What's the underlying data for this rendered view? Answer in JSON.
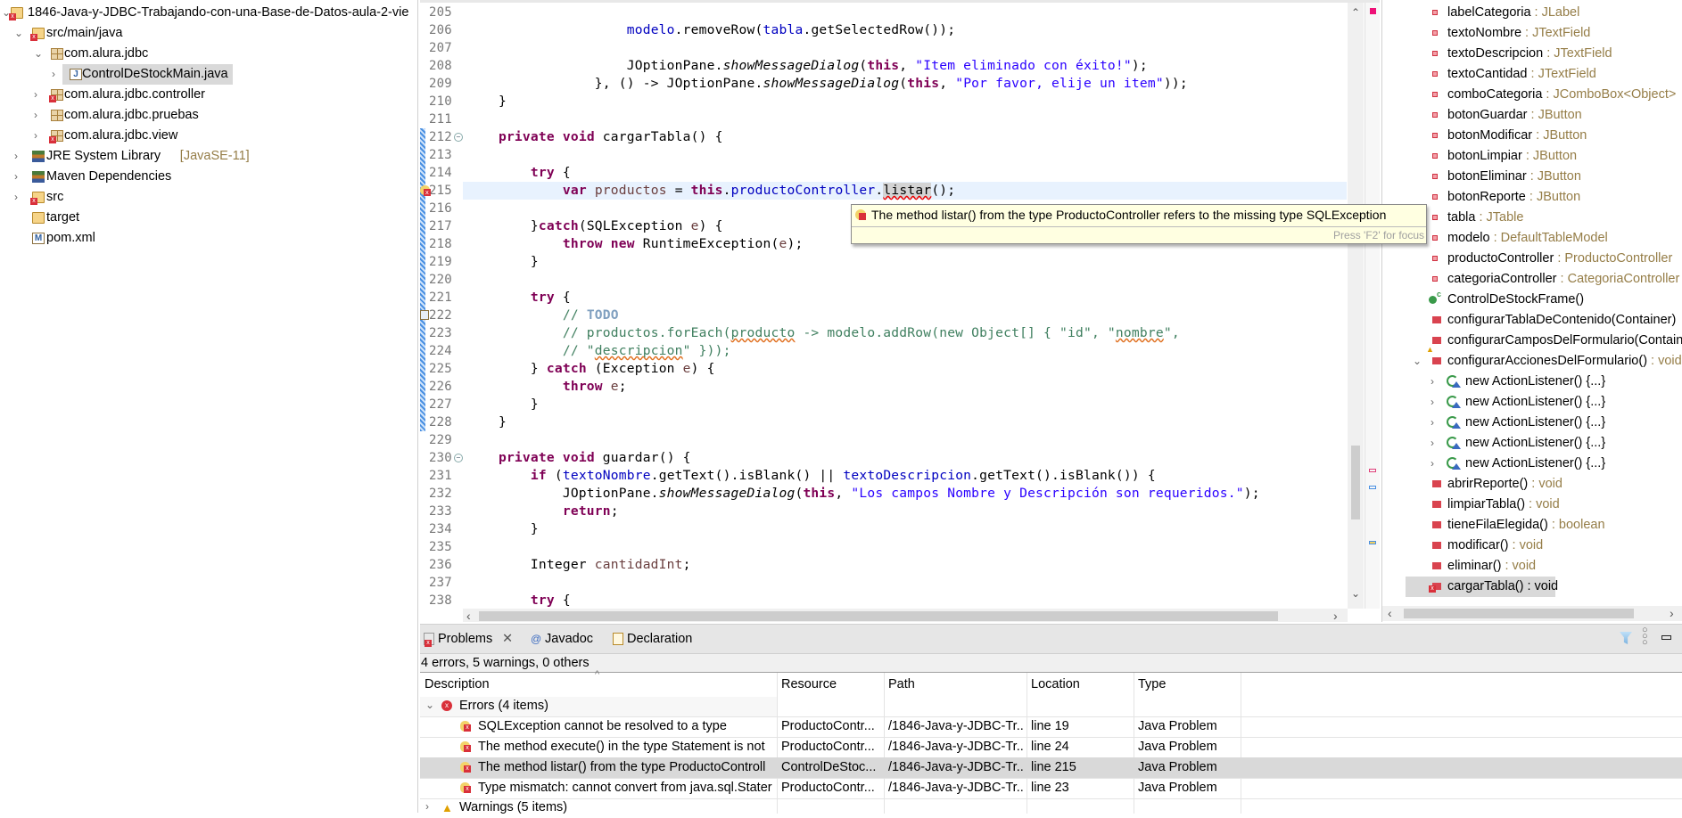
{
  "explorer": {
    "items": [
      {
        "label": "1846-Java-y-JDBC-Trabajando-con-una-Base-de-Datos-aula-2-vie",
        "icon": "maven-project-icon",
        "level": 0,
        "chevron": "open",
        "error": true
      },
      {
        "label": "src/main/java",
        "icon": "source-folder-icon",
        "level": 1,
        "chevron": "open",
        "error": true
      },
      {
        "label": "com.alura.jdbc",
        "icon": "package-icon",
        "level": 2,
        "chevron": "open",
        "error": false
      },
      {
        "label": "ControlDeStockMain.java",
        "icon": "java-file-icon",
        "level": 3,
        "chevron": "closed",
        "error": false,
        "selected": true
      },
      {
        "label": "com.alura.jdbc.controller",
        "icon": "package-icon",
        "level": 2,
        "chevron": "closed",
        "error": true
      },
      {
        "label": "com.alura.jdbc.pruebas",
        "icon": "package-icon",
        "level": 2,
        "chevron": "closed",
        "error": false
      },
      {
        "label": "com.alura.jdbc.view",
        "icon": "package-icon",
        "level": 2,
        "chevron": "closed",
        "error": true
      },
      {
        "label": "JRE System Library",
        "suffix": "[JavaSE-11]",
        "icon": "library-icon",
        "level": 1,
        "chevron": "closed",
        "error": false
      },
      {
        "label": "Maven Dependencies",
        "icon": "library-icon",
        "level": 1,
        "chevron": "closed",
        "error": false
      },
      {
        "label": "src",
        "icon": "folder-icon",
        "level": 1,
        "chevron": "closed",
        "error": true
      },
      {
        "label": "target",
        "icon": "folder-icon",
        "level": 1,
        "chevron": "none",
        "error": false
      },
      {
        "label": "pom.xml",
        "icon": "maven-pom-icon",
        "level": 1,
        "chevron": "none",
        "error": false
      }
    ]
  },
  "editor": {
    "current_line": 215,
    "lines": [
      {
        "n": "205",
        "t": []
      },
      {
        "n": "206",
        "t": [
          [
            "                    ",
            ""
          ],
          [
            "modelo",
            "fld"
          ],
          [
            ".removeRow(",
            ""
          ],
          [
            "tabla",
            "fld"
          ],
          [
            ".getSelectedRow());",
            ""
          ]
        ]
      },
      {
        "n": "207",
        "t": []
      },
      {
        "n": "208",
        "t": [
          [
            "                    JOptionPane.",
            ""
          ],
          [
            "showMessageDialog",
            "it"
          ],
          [
            "(",
            ""
          ],
          [
            "this",
            "kw"
          ],
          [
            ", ",
            ""
          ],
          [
            "\"Item eliminado con éxito!\"",
            "str"
          ],
          [
            ");",
            ""
          ]
        ]
      },
      {
        "n": "209",
        "t": [
          [
            "                }, () -> JOptionPane.",
            ""
          ],
          [
            "showMessageDialog",
            "it"
          ],
          [
            "(",
            ""
          ],
          [
            "this",
            "kw"
          ],
          [
            ", ",
            ""
          ],
          [
            "\"Por favor, elije un item\"",
            "str"
          ],
          [
            "));",
            ""
          ]
        ]
      },
      {
        "n": "210",
        "t": [
          [
            "    }",
            ""
          ]
        ]
      },
      {
        "n": "211",
        "t": []
      },
      {
        "n": "212",
        "t": [
          [
            "    ",
            ""
          ],
          [
            "private",
            "kw"
          ],
          [
            " ",
            ""
          ],
          [
            "void",
            "kw"
          ],
          [
            " cargarTabla() {",
            ""
          ]
        ],
        "fold": true
      },
      {
        "n": "213",
        "t": []
      },
      {
        "n": "214",
        "t": [
          [
            "        ",
            ""
          ],
          [
            "try",
            "kw"
          ],
          [
            " {",
            ""
          ]
        ]
      },
      {
        "n": "215",
        "t": [
          [
            "            ",
            ""
          ],
          [
            "var",
            "kw"
          ],
          [
            " ",
            ""
          ],
          [
            "productos",
            "loc"
          ],
          [
            " = ",
            ""
          ],
          [
            "this",
            "kw"
          ],
          [
            ".",
            ""
          ],
          [
            "productoController",
            "fld"
          ],
          [
            ".",
            ""
          ],
          [
            "listar",
            "occ"
          ],
          [
            "();",
            ""
          ]
        ],
        "error": true
      },
      {
        "n": "216",
        "t": []
      },
      {
        "n": "217",
        "t": [
          [
            "        }",
            ""
          ],
          [
            "catch",
            "kw"
          ],
          [
            "(SQLException ",
            ""
          ],
          [
            "e",
            "loc"
          ],
          [
            ") {",
            ""
          ]
        ]
      },
      {
        "n": "218",
        "t": [
          [
            "            ",
            ""
          ],
          [
            "throw",
            "kw"
          ],
          [
            " ",
            ""
          ],
          [
            "new",
            "kw"
          ],
          [
            " RuntimeException(",
            ""
          ],
          [
            "e",
            "loc"
          ],
          [
            ");",
            ""
          ]
        ]
      },
      {
        "n": "219",
        "t": [
          [
            "        }",
            ""
          ]
        ]
      },
      {
        "n": "220",
        "t": []
      },
      {
        "n": "221",
        "t": [
          [
            "        ",
            ""
          ],
          [
            "try",
            "kw"
          ],
          [
            " {",
            ""
          ]
        ]
      },
      {
        "n": "222",
        "t": [
          [
            "            ",
            ""
          ],
          [
            "// ",
            "cm"
          ],
          [
            "TODO",
            "todo"
          ]
        ],
        "task": true
      },
      {
        "n": "223",
        "t": [
          [
            "            ",
            ""
          ],
          [
            "// productos.forEach(",
            "cm"
          ],
          [
            "producto",
            "cm sq"
          ],
          [
            " -> modelo.addRow(new Object[] { \"id\", \"",
            "cm"
          ],
          [
            "nombre",
            "cm sq"
          ],
          [
            "\",",
            "cm"
          ]
        ]
      },
      {
        "n": "224",
        "t": [
          [
            "            ",
            ""
          ],
          [
            "// \"",
            "cm"
          ],
          [
            "descripcion",
            "cm sq"
          ],
          [
            "\" }));",
            "cm"
          ]
        ]
      },
      {
        "n": "225",
        "t": [
          [
            "        } ",
            ""
          ],
          [
            "catch",
            "kw"
          ],
          [
            " (Exception ",
            ""
          ],
          [
            "e",
            "loc"
          ],
          [
            ") {",
            ""
          ]
        ]
      },
      {
        "n": "226",
        "t": [
          [
            "            ",
            ""
          ],
          [
            "throw",
            "kw"
          ],
          [
            " ",
            ""
          ],
          [
            "e",
            "loc"
          ],
          [
            ";",
            ""
          ]
        ]
      },
      {
        "n": "227",
        "t": [
          [
            "        }",
            ""
          ]
        ]
      },
      {
        "n": "228",
        "t": [
          [
            "    }",
            ""
          ]
        ]
      },
      {
        "n": "229",
        "t": []
      },
      {
        "n": "230",
        "t": [
          [
            "    ",
            ""
          ],
          [
            "private",
            "kw"
          ],
          [
            " ",
            ""
          ],
          [
            "void",
            "kw"
          ],
          [
            " guardar() {",
            ""
          ]
        ],
        "fold": true
      },
      {
        "n": "231",
        "t": [
          [
            "        ",
            ""
          ],
          [
            "if",
            "kw"
          ],
          [
            " (",
            ""
          ],
          [
            "textoNombre",
            "fld"
          ],
          [
            ".getText().isBlank() || ",
            ""
          ],
          [
            "textoDescripcion",
            "fld"
          ],
          [
            ".getText().isBlank()) {",
            ""
          ]
        ]
      },
      {
        "n": "232",
        "t": [
          [
            "            JOptionPane.",
            ""
          ],
          [
            "showMessageDialog",
            "it"
          ],
          [
            "(",
            ""
          ],
          [
            "this",
            "kw"
          ],
          [
            ", ",
            ""
          ],
          [
            "\"Los campos Nombre y Descripción son requeridos.\"",
            "str"
          ],
          [
            ");",
            ""
          ]
        ]
      },
      {
        "n": "233",
        "t": [
          [
            "            ",
            ""
          ],
          [
            "return",
            "kw"
          ],
          [
            ";",
            ""
          ]
        ]
      },
      {
        "n": "234",
        "t": [
          [
            "        }",
            ""
          ]
        ]
      },
      {
        "n": "235",
        "t": []
      },
      {
        "n": "236",
        "t": [
          [
            "        Integer ",
            ""
          ],
          [
            "cantidadInt",
            "loc"
          ],
          [
            ";",
            ""
          ]
        ]
      },
      {
        "n": "237",
        "t": []
      },
      {
        "n": "238",
        "t": [
          [
            "        ",
            ""
          ],
          [
            "try",
            "kw"
          ],
          [
            " {",
            ""
          ]
        ]
      }
    ]
  },
  "tooltip": {
    "message": "The method listar() from the type ProductoController refers to the missing type SQLException",
    "hint": "Press 'F2' for focus"
  },
  "outline": {
    "items": [
      {
        "name": "labelCategoria",
        "type": " : JLabel",
        "kind": "field"
      },
      {
        "name": "textoNombre",
        "type": " : JTextField",
        "kind": "field"
      },
      {
        "name": "textoDescripcion",
        "type": " : JTextField",
        "kind": "field"
      },
      {
        "name": "textoCantidad",
        "type": " : JTextField",
        "kind": "field"
      },
      {
        "name": "comboCategoria",
        "type": " : JComboBox<Object>",
        "kind": "field"
      },
      {
        "name": "botonGuardar",
        "type": " : JButton",
        "kind": "field"
      },
      {
        "name": "botonModificar",
        "type": " : JButton",
        "kind": "field"
      },
      {
        "name": "botonLimpiar",
        "type": " : JButton",
        "kind": "field"
      },
      {
        "name": "botonEliminar",
        "type": " : JButton",
        "kind": "field"
      },
      {
        "name": "botonReporte",
        "type": " : JButton",
        "kind": "field"
      },
      {
        "name": "tabla",
        "type": " : JTable",
        "kind": "field"
      },
      {
        "name": "modelo",
        "type": " : DefaultTableModel",
        "kind": "field"
      },
      {
        "name": "productoController",
        "type": " : ProductoController",
        "kind": "field"
      },
      {
        "name": "categoriaController",
        "type": " : CategoriaController",
        "kind": "field"
      },
      {
        "name": "ControlDeStockFrame()",
        "type": "",
        "kind": "constructor"
      },
      {
        "name": "configurarTablaDeContenido(Container)",
        "type": "",
        "kind": "method"
      },
      {
        "name": "configurarCamposDelFormulario(Container)",
        "type": "",
        "kind": "method-warning"
      },
      {
        "name": "configurarAccionesDelFormulario()",
        "type": " : void",
        "kind": "method",
        "expanded": true
      },
      {
        "name": "new ActionListener() {...}",
        "type": "",
        "kind": "anon"
      },
      {
        "name": "new ActionListener() {...}",
        "type": "",
        "kind": "anon"
      },
      {
        "name": "new ActionListener() {...}",
        "type": "",
        "kind": "anon"
      },
      {
        "name": "new ActionListener() {...}",
        "type": "",
        "kind": "anon"
      },
      {
        "name": "new ActionListener() {...}",
        "type": "",
        "kind": "anon"
      },
      {
        "name": "abrirReporte()",
        "type": " : void",
        "kind": "method"
      },
      {
        "name": "limpiarTabla()",
        "type": " : void",
        "kind": "method"
      },
      {
        "name": "tieneFilaElegida()",
        "type": " : boolean",
        "kind": "method"
      },
      {
        "name": "modificar()",
        "type": " : void",
        "kind": "method"
      },
      {
        "name": "eliminar()",
        "type": " : void",
        "kind": "method"
      },
      {
        "name": "cargarTabla()",
        "type": " : void",
        "kind": "method-error",
        "selected": true
      }
    ]
  },
  "problems": {
    "tabs": [
      {
        "label": "Problems",
        "icon": "problems-icon",
        "active": true
      },
      {
        "label": "Javadoc",
        "icon": "javadoc-icon"
      },
      {
        "label": "Declaration",
        "icon": "declaration-icon"
      }
    ],
    "summary": "4 errors, 5 warnings, 0 others",
    "columns": [
      "Description",
      "Resource",
      "Path",
      "Location",
      "Type"
    ],
    "errors_group": "Errors (4 items)",
    "warnings_group": "Warnings (5 items)",
    "rows": [
      {
        "description": "SQLException cannot be resolved to a type",
        "resource": "ProductoContr...",
        "path": "/1846-Java-y-JDBC-Tr...",
        "location": "line 19",
        "type": "Java Problem"
      },
      {
        "description": "The method execute() in the type Statement is not",
        "resource": "ProductoContr...",
        "path": "/1846-Java-y-JDBC-Tr...",
        "location": "line 24",
        "type": "Java Problem"
      },
      {
        "description": "The method listar() from the type ProductoControll",
        "resource": "ControlDeStoc...",
        "path": "/1846-Java-y-JDBC-Tr...",
        "location": "line 215",
        "type": "Java Problem",
        "selected": true
      },
      {
        "description": "Type mismatch: cannot convert from java.sql.Stater",
        "resource": "ProductoContr...",
        "path": "/1846-Java-y-JDBC-Tr...",
        "location": "line 23",
        "type": "Java Problem"
      }
    ]
  },
  "colors": {
    "keyword": "#7f0055",
    "field": "#0000c0",
    "string": "#2a00ff",
    "comment": "#3f7f5f",
    "current_line": "#e8f2fe",
    "selection": "#d9d9d9",
    "error": "#d9303a"
  }
}
